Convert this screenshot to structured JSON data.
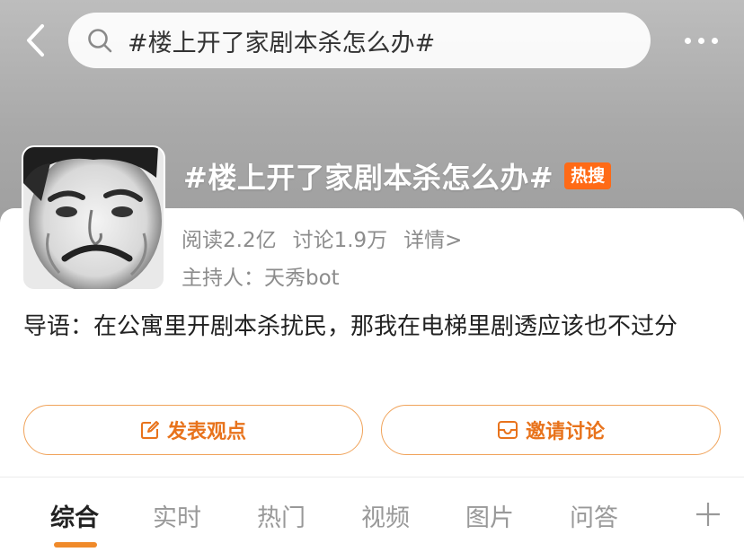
{
  "search": {
    "query": "#楼上开了家剧本杀怎么办#"
  },
  "topic": {
    "title": "#楼上开了家剧本杀怎么办#",
    "badge": "热搜",
    "reads": "阅读2.2亿",
    "discussions": "讨论1.9万",
    "details_link": "详情>",
    "host": "主持人：天秀bot"
  },
  "intro": "导语：在公寓里开剧本杀扰民，那我在电梯里剧透应该也不过分",
  "actions": {
    "post": "发表观点",
    "invite": "邀请讨论"
  },
  "tabs": [
    "综合",
    "实时",
    "热门",
    "视频",
    "图片",
    "问答"
  ],
  "colors": {
    "accent": "#e8731c",
    "badge": "#ff6a16",
    "indicator": "#f08a2a"
  }
}
